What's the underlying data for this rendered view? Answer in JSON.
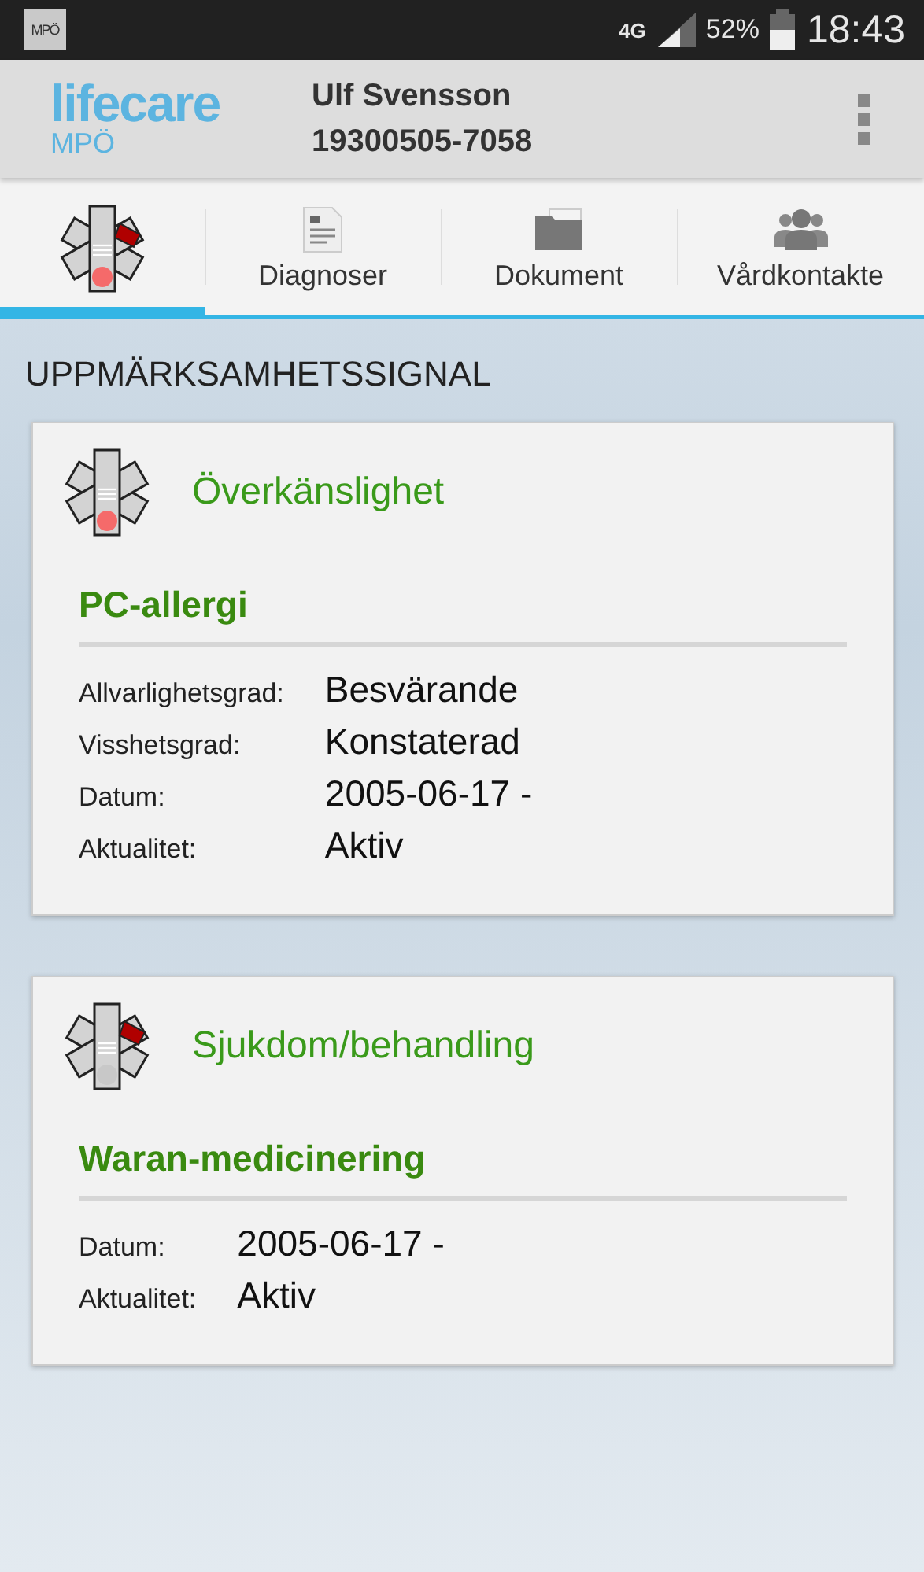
{
  "status_bar": {
    "app_badge": "MPÖ",
    "network": "4G",
    "battery": "52%",
    "time": "18:43"
  },
  "header": {
    "logo": "lifecare",
    "logo_sub": "MPÖ",
    "patient_name": "Ulf Svensson",
    "patient_id": "19300505-7058"
  },
  "tabs": [
    {
      "kind": "signal",
      "selected": true,
      "arm_marked": true,
      "dot_marked": true
    },
    {
      "kind": "document",
      "label": "Diagnoser",
      "selected": false
    },
    {
      "kind": "folder",
      "label": "Dokument",
      "selected": false
    },
    {
      "kind": "people",
      "label": "Vårdkontakte",
      "selected": false
    }
  ],
  "section_title": "UPPMÄRKSAMHETSSIGNAL",
  "cards": [
    {
      "category": "Överkänslighet",
      "arm_marked": false,
      "dot_marked": true,
      "title": "PC-allergi",
      "fields": [
        {
          "label": "Allvarlighetsgrad:",
          "value": "Besvärande"
        },
        {
          "label": "Visshetsgrad:",
          "value": "Konstaterad"
        },
        {
          "label": "Datum:",
          "value": "2005-06-17 -"
        },
        {
          "label": "Aktualitet:",
          "value": "Aktiv"
        }
      ]
    },
    {
      "category": "Sjukdom/behandling",
      "arm_marked": true,
      "dot_marked": false,
      "title": "Waran-medicinering",
      "fields": [
        {
          "label": "Datum:",
          "value": "2005-06-17 -"
        },
        {
          "label": "Aktualitet:",
          "value": "Aktiv"
        }
      ]
    }
  ]
}
